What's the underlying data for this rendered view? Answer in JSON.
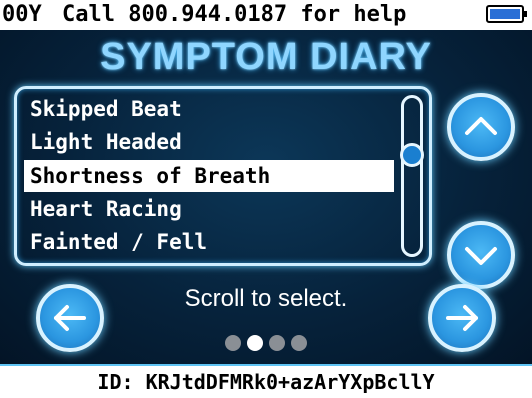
{
  "status_bar": {
    "signal": "00Y",
    "help_text": "Call 800.944.0187 for help",
    "battery_icon": "battery-full-icon"
  },
  "title": "SYMPTOM DIARY",
  "symptoms": [
    {
      "label": "Skipped Beat",
      "selected": false
    },
    {
      "label": "Light Headed",
      "selected": false
    },
    {
      "label": "Shortness of Breath",
      "selected": true
    },
    {
      "label": "Heart Racing",
      "selected": false
    },
    {
      "label": "Fainted / Fell",
      "selected": false
    }
  ],
  "hint": "Scroll to select.",
  "pagination": {
    "pages": 4,
    "current": 2
  },
  "footer": {
    "id_text": "ID: KRJtdDFMRk0+azArYXpBcllY"
  },
  "colors": {
    "accent": "#2b96e0",
    "glow": "#6cd0ff",
    "panel_bg": "#06223b"
  }
}
